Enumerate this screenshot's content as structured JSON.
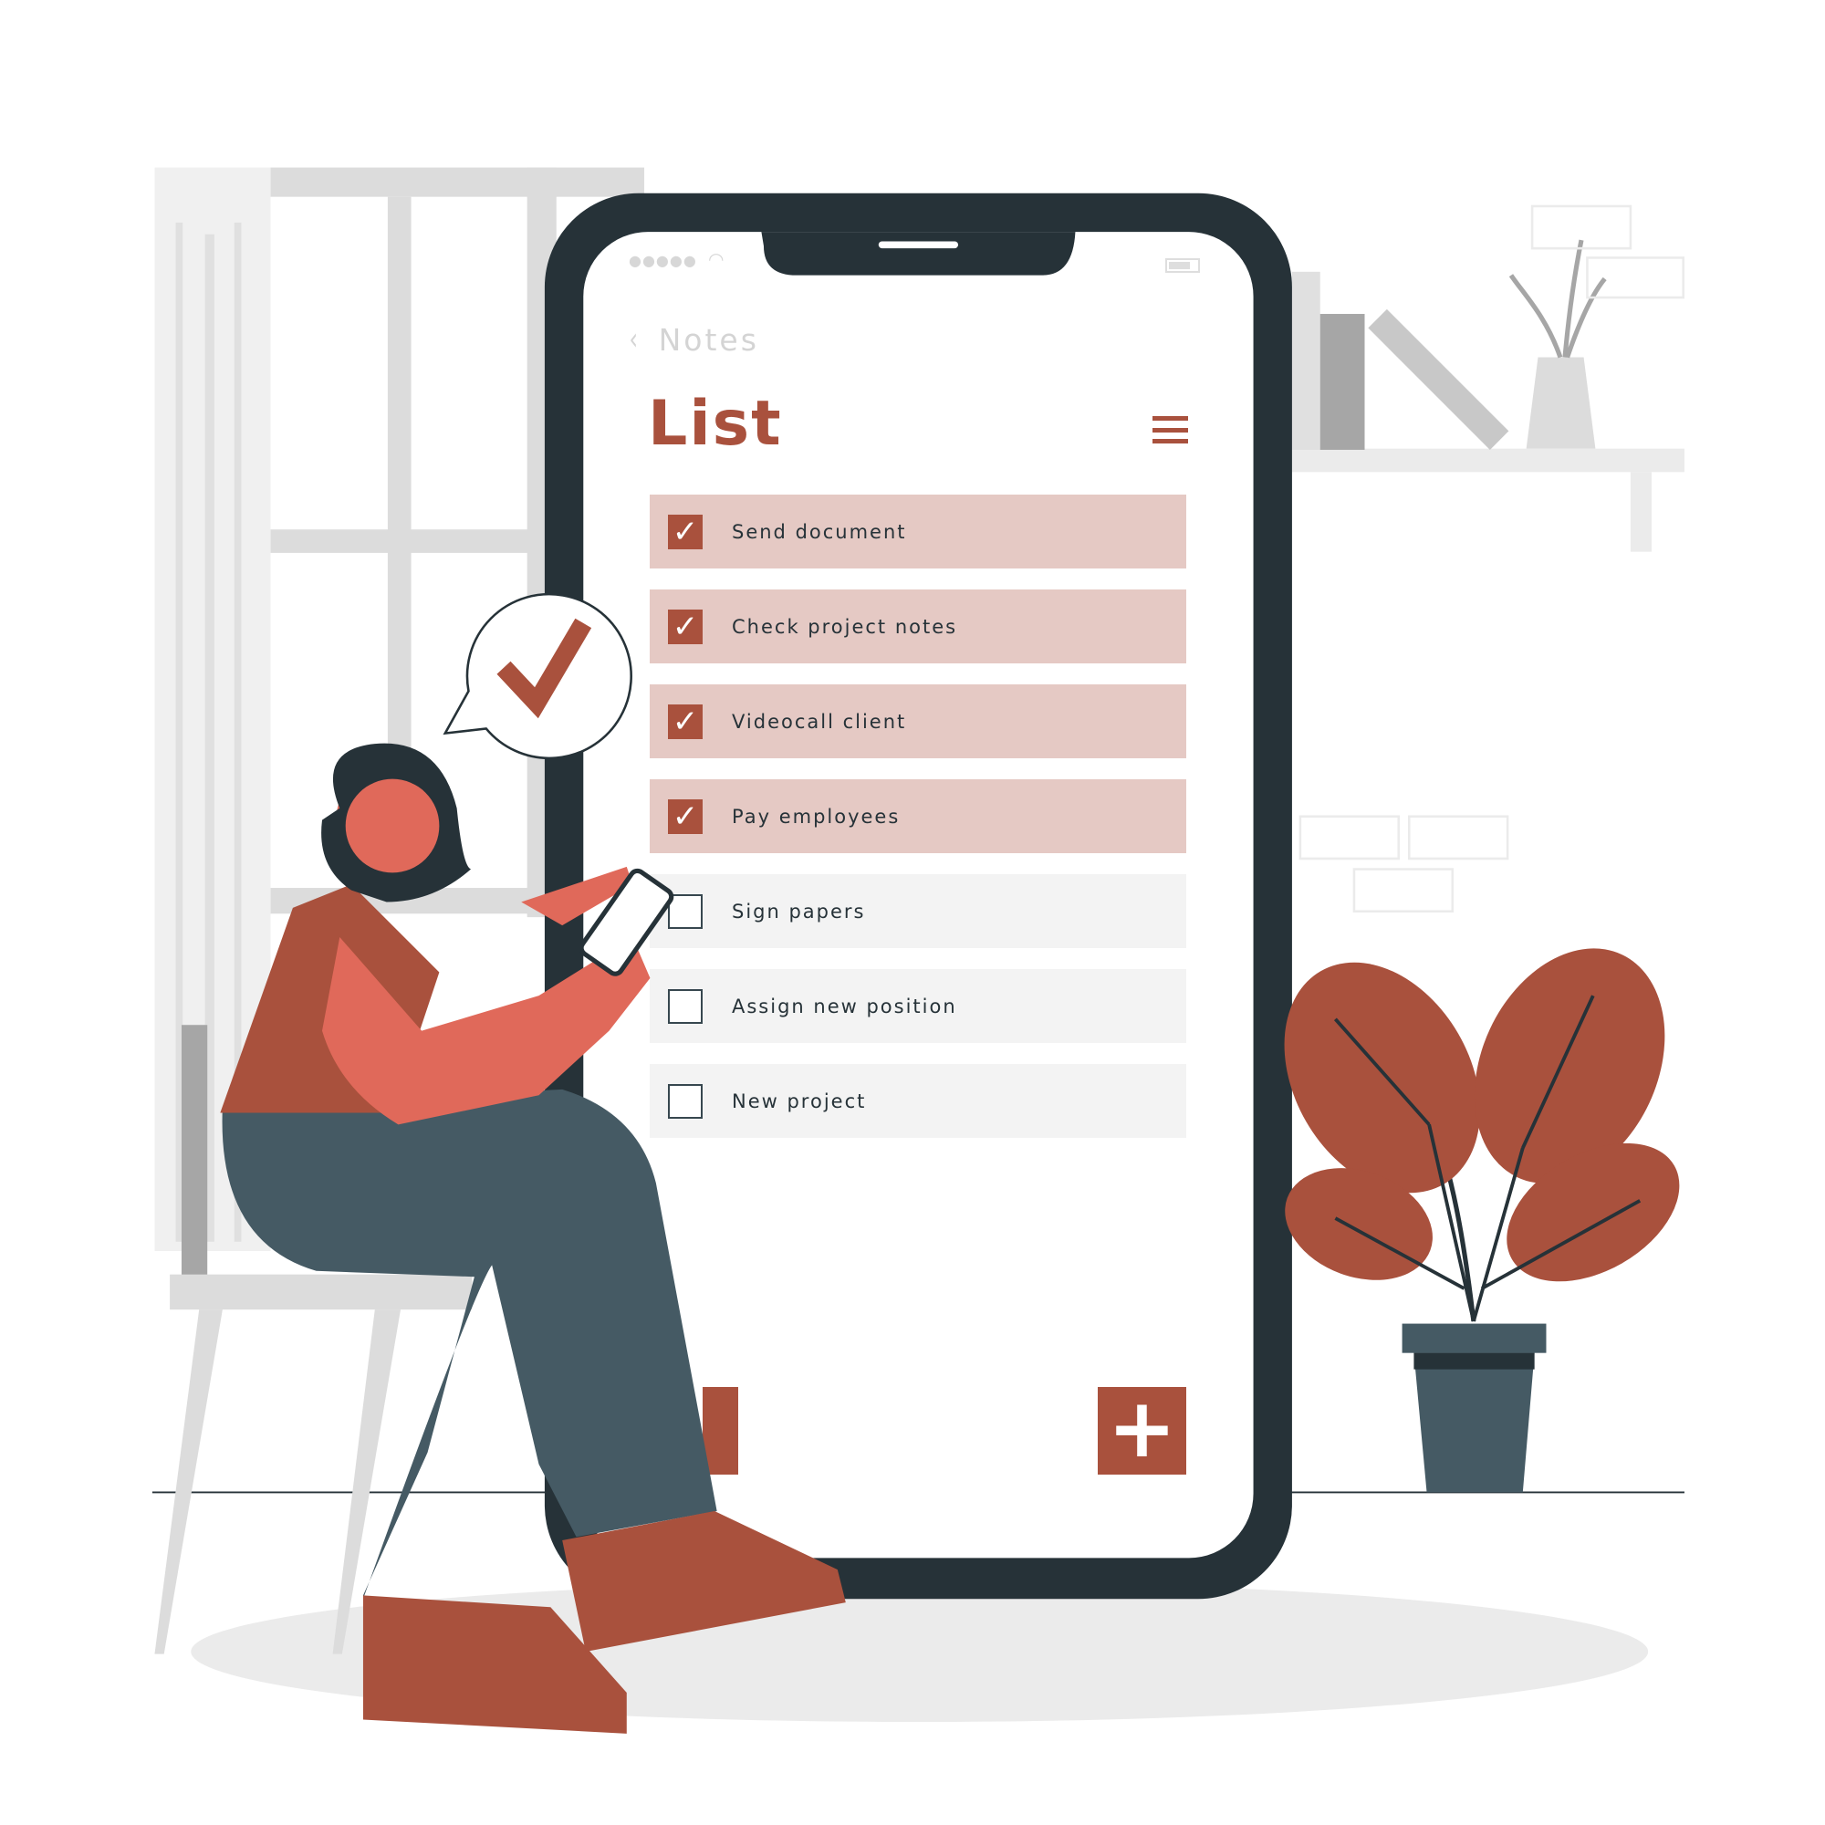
{
  "colors": {
    "accent": "#a9513d",
    "done_row": "#e5c9c4",
    "todo_row": "#f3f3f3",
    "phone_frame": "#263238",
    "skin": "#e0695a",
    "pants": "#455a64"
  },
  "status_bar": {
    "signal": "●●●●●",
    "wifi_icon": "wifi-icon",
    "battery_icon": "battery-icon"
  },
  "nav": {
    "back_label": "Notes",
    "back_icon": "‹"
  },
  "header": {
    "title": "List",
    "menu_icon": "hamburger-icon"
  },
  "items": [
    {
      "label": "Send document",
      "done": true
    },
    {
      "label": "Check project notes",
      "done": true
    },
    {
      "label": "Videocall client",
      "done": true
    },
    {
      "label": "Pay employees",
      "done": true
    },
    {
      "label": "Sign papers",
      "done": false
    },
    {
      "label": "Assign new position",
      "done": false
    },
    {
      "label": "New project",
      "done": false
    }
  ],
  "check_glyph": "✓",
  "fab": {
    "label": "+",
    "icon": "plus-icon"
  }
}
